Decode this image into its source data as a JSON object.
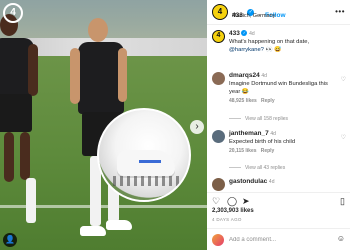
{
  "post": {
    "username": "433",
    "verified_glyph": "✓",
    "follow_label": "Follow",
    "separator": "•",
    "location": "Munich, Germany",
    "more_glyph": "•••",
    "avatar_text": "4"
  },
  "caption": {
    "username": "433",
    "age": "4d",
    "text_line1": "What's happening on that date,",
    "mention": "@harrykane?",
    "emoji": "👀 😅"
  },
  "comments": [
    {
      "username": "dmarqs24",
      "age": "4d",
      "text": "Imagine Dortmund win Bundesliga this year 😂",
      "likes_count": "48,925 likes",
      "reply_label": "Reply",
      "replies_label": "View all 158 replies",
      "avatar_color": "#8a6a55"
    },
    {
      "username": "jantheman_7",
      "age": "4d",
      "text": "Expected birth of his child",
      "likes_count": "20,115 likes",
      "reply_label": "Reply",
      "replies_label": "View all 43 replies",
      "avatar_color": "#5a6c7c"
    },
    {
      "username": "gastondulac",
      "age": "4d",
      "avatar_color": "#7c5f48"
    }
  ],
  "actions": {
    "like_icon": "♡",
    "comment_icon": "◯",
    "share_icon": "➤",
    "save_icon": "▯"
  },
  "stats": {
    "likes": "2,303,903 likes",
    "ago": "4 DAYS AGO"
  },
  "composer": {
    "placeholder": "Add a comment...",
    "emoji_icon": "☺"
  },
  "media": {
    "watermark": "④",
    "next_glyph": "›",
    "profile_glyph": "👤"
  },
  "colors": {
    "accent_blue": "#0095f6",
    "brand_yellow": "#f5d10e"
  }
}
